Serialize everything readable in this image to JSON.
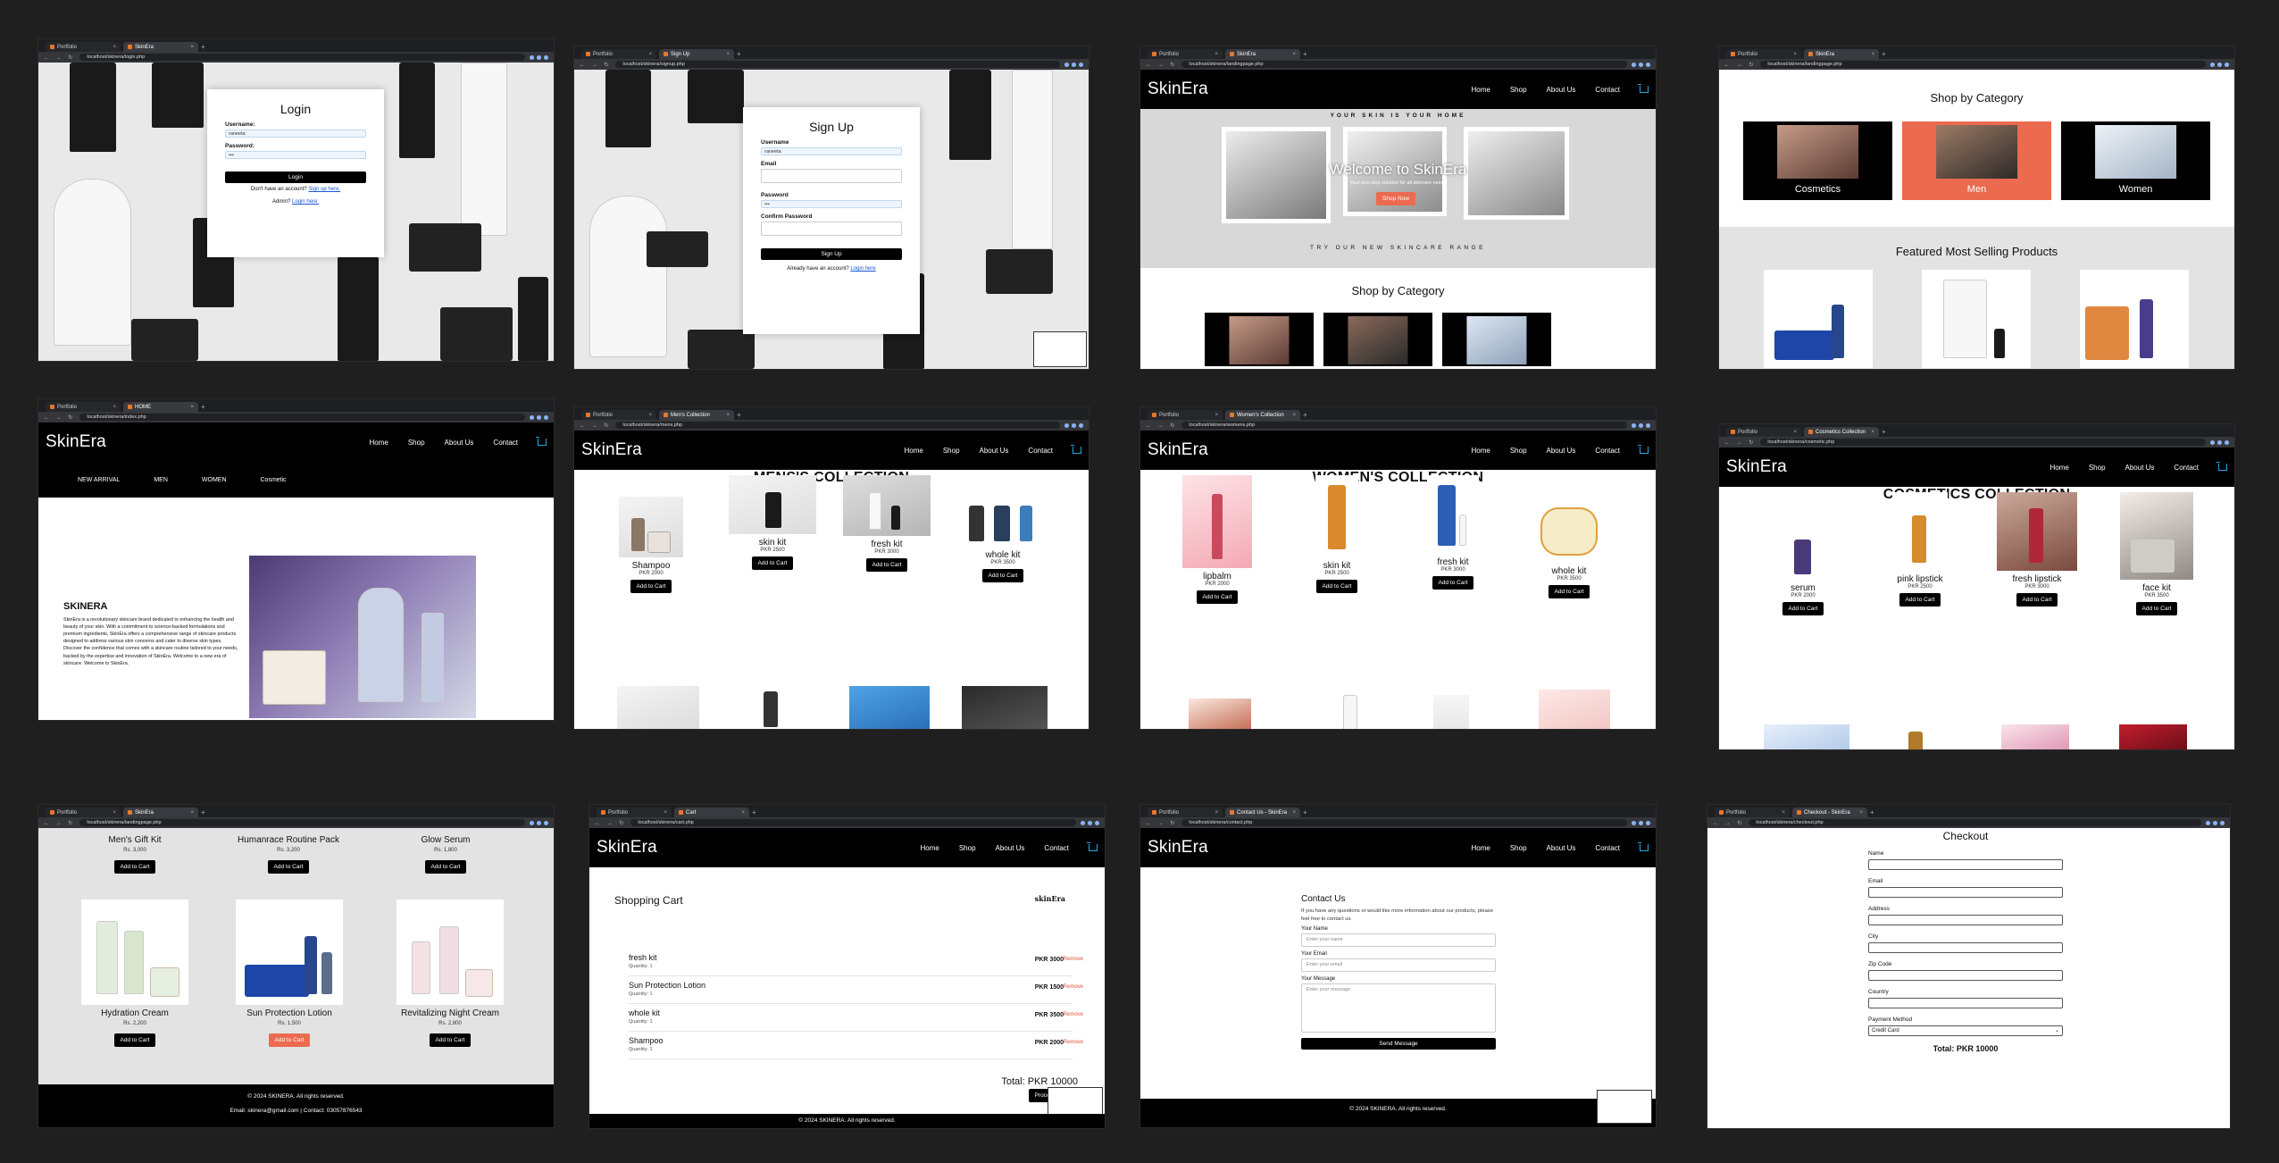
{
  "browser": {
    "tab_portfolio": "Portfolio",
    "urls": {
      "login": "localhost/skinera/login.php",
      "signup": "localhost/skinera/signup.php",
      "landing": "localhost/skinera/landingpage.php",
      "index": "localhost/skinera/index.php",
      "men": "localhost/skinera/mens.php",
      "women": "localhost/skinera/womens.php",
      "cosmetic": "localhost/skinera/cosmetic.php",
      "cart": "localhost/skinera/cart.php",
      "contact": "localhost/skinera/contact.php",
      "checkout": "localhost/skinera/checkout.php"
    },
    "tabs": {
      "login": "SkinEra",
      "signup": "Sign Up",
      "landing": "SkinEra",
      "landing2": "SkinEra",
      "index": "HOME",
      "men": "Men's Collection",
      "women": "Women's Collection",
      "cosmetic": "Cosmetics Collection",
      "landing3": "SkinEra",
      "cart": "Cart",
      "contact": "Contact Us - SkinEra",
      "checkout": "Checkout - SkinEra"
    }
  },
  "nav": {
    "logo": "SkinEra",
    "home": "Home",
    "shop": "Shop",
    "about": "About Us",
    "contact": "Contact"
  },
  "login": {
    "title": "Login",
    "username_label": "Username:",
    "username_value": "raneeta",
    "password_label": "Password:",
    "password_value": "•••",
    "button": "Login",
    "no_account": "Don't have an account?",
    "signup_link": "Sign up here.",
    "admin": "Admin?",
    "admin_link": "Login here."
  },
  "signup": {
    "title": "Sign Up",
    "username_label": "Username",
    "username_value": "raneeta",
    "email_label": "Email",
    "password_label": "Password",
    "password_value": "•••",
    "confirm_label": "Confirm Password",
    "button": "Sign Up",
    "have_account": "Already have an account?",
    "login_link": "Login here"
  },
  "landing": {
    "tagline": "YOUR SKIN IS YOUR HOME",
    "welcome": "Welcome to SkinEra",
    "subtext": "Your one-stop solution for all skincare needs",
    "shop_now": "Shop Now",
    "range": "TRY OUR NEW SKINCARE RANGE",
    "shop_by_category": "Shop by Category",
    "featured": "Featured Most Selling Products",
    "categories": [
      "Cosmetics",
      "Men",
      "Women"
    ]
  },
  "index": {
    "subnav": [
      "NEW ARRIVAL",
      "MEN",
      "WOMEN",
      "Cosmetic"
    ],
    "brand": "SKINERA",
    "about": "SkinEra is a revolutionary skincare brand dedicated to enhancing the health and beauty of your skin. With a commitment to science-backed formulations and premium ingredients, SkinEra offers a comprehensive range of skincare products designed to address various skin concerns and cater to diverse skin types. Discover the confidence that comes with a skincare routine tailored to your needs, backed by the expertise and innovation of SkinEra. Welcome to a new era of skincare. Welcome to SkinEra."
  },
  "add_to_cart": "Add to Cart",
  "men": {
    "title": "MENS'S COLLECTION",
    "products": [
      {
        "name": "Shampoo",
        "price": "PKR 2000"
      },
      {
        "name": "skin kit",
        "price": "PKR 2500"
      },
      {
        "name": "fresh kit",
        "price": "PKR 3000"
      },
      {
        "name": "whole kit",
        "price": "PKR 3500"
      }
    ]
  },
  "women": {
    "title": "WOMEN'S COLLECTION",
    "products": [
      {
        "name": "lipbalm",
        "price": "PKR 2000"
      },
      {
        "name": "skin kit",
        "price": "PKR 2500"
      },
      {
        "name": "fresh kit",
        "price": "PKR 3000"
      },
      {
        "name": "whole kit",
        "price": "PKR 3500"
      }
    ]
  },
  "cosmetic": {
    "title": "COSMETICS COLLECTION",
    "products": [
      {
        "name": "serum",
        "price": "PKR 2000"
      },
      {
        "name": "pink lipstick",
        "price": "PKR 2500"
      },
      {
        "name": "fresh lipstick",
        "price": "PKR 3000"
      },
      {
        "name": "face kit",
        "price": "PKR 3500"
      }
    ]
  },
  "featured_grid": {
    "products": [
      {
        "name": "Men's Gift Kit",
        "price": "Rs. 3,000"
      },
      {
        "name": "Humanrace Routine Pack",
        "price": "Rs. 3,200"
      },
      {
        "name": "Glow Serum",
        "price": "Rs. 1,800"
      },
      {
        "name": "Hydration Cream",
        "price": "Rs. 2,200"
      },
      {
        "name": "Sun Protection Lotion",
        "price": "Rs. 1,500"
      },
      {
        "name": "Revitalizing Night Cream",
        "price": "Rs. 2,800"
      }
    ],
    "footer_copyright": "© 2024 SKINERA. All rights reserved.",
    "footer_contact": "Email: skinera@gmail.com | Contact: 03057876543"
  },
  "cart": {
    "title": "Shopping Cart",
    "brand_mark": "skinEra",
    "remove": "Remove",
    "items": [
      {
        "name": "fresh kit",
        "qty": "Quantity: 1",
        "price": "PKR 3000"
      },
      {
        "name": "Sun Protection Lotion",
        "qty": "Quantity: 1",
        "price": "PKR 1500"
      },
      {
        "name": "whole kit",
        "qty": "Quantity: 1",
        "price": "PKR 3500"
      },
      {
        "name": "Shampoo",
        "qty": "Quantity: 1",
        "price": "PKR 2000"
      }
    ],
    "total": "Total: PKR 10000",
    "proceed": "Proceed to",
    "footer": "© 2024 SKINERA. All rights reserved."
  },
  "contact": {
    "title": "Contact Us",
    "intro": "If you have any questions or would like more information about our products, please feel free to contact us.",
    "name_label": "Your Name",
    "name_ph": "Enter your name",
    "email_label": "Your Email",
    "email_ph": "Enter your email",
    "msg_label": "Your Message",
    "msg_ph": "Enter your message",
    "send": "Send Message",
    "footer": "© 2024 SKINERA. All rights reserved."
  },
  "checkout": {
    "title": "Checkout",
    "fields": [
      "Name",
      "Email",
      "Address",
      "City",
      "Zip Code",
      "Country"
    ],
    "payment_label": "Payment Method",
    "payment_value": "Credit Card",
    "total": "Total: PKR 10000"
  }
}
